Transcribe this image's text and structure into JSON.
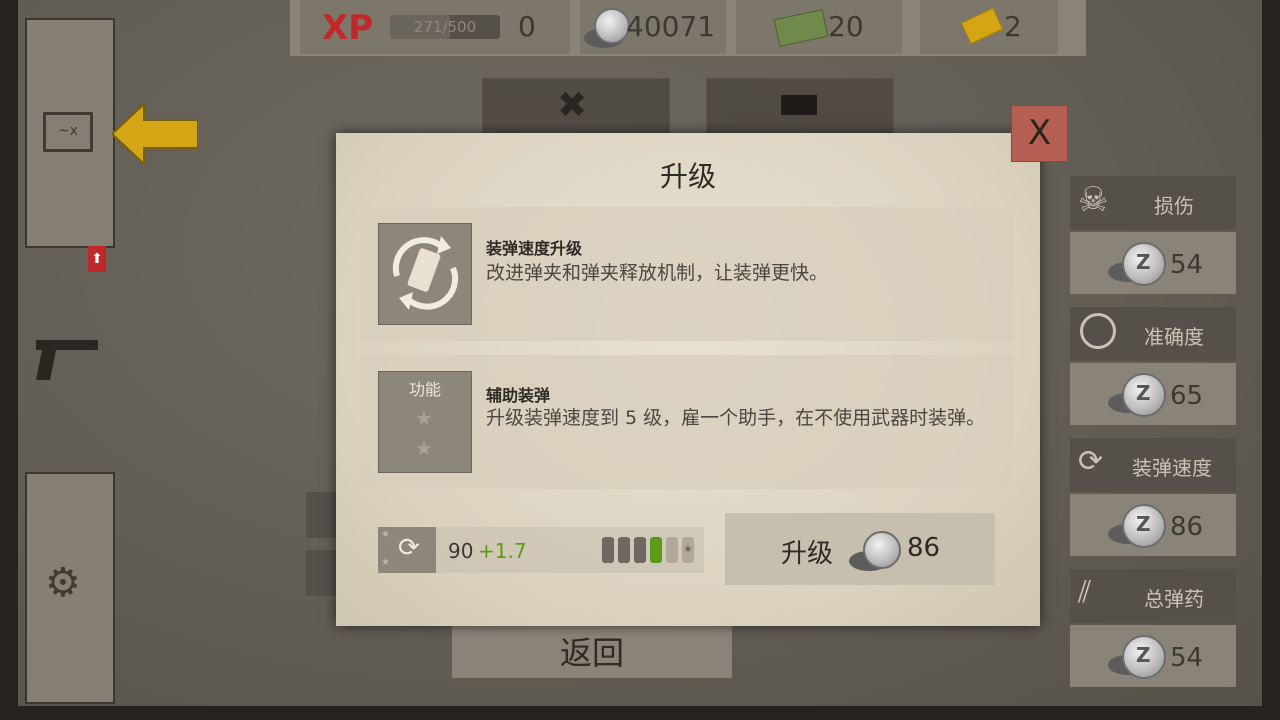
{
  "topbar": {
    "xp_label": "XP",
    "xp_progress": "271/500",
    "xp_value": "0",
    "coins": "40071",
    "cash": "20",
    "gold": "2"
  },
  "modal": {
    "title": "升级",
    "close_label": "X",
    "upgrade1": {
      "title": "装弹速度升级",
      "description": "改进弹夹和弹夹释放机制，让装弹更快。"
    },
    "upgrade2": {
      "tile_label": "功能",
      "title": "辅助装弹",
      "description": "升级装弹速度到 5 级，雇一个助手，在不使用武器时装弹。"
    },
    "stat": {
      "value": "90",
      "bonus": "+1.7",
      "level": 4,
      "max_level": 6
    },
    "upgrade_button": {
      "label": "升级",
      "cost": "86"
    }
  },
  "back_label": "返回",
  "stats": [
    {
      "label": "损伤",
      "cost": "54",
      "icon": "skull-icon"
    },
    {
      "label": "准确度",
      "cost": "65",
      "icon": "crosshair-icon"
    },
    {
      "label": "装弹速度",
      "cost": "86",
      "icon": "reload-icon"
    },
    {
      "label": "总弹药",
      "cost": "54",
      "icon": "ammo-icon"
    }
  ],
  "colors": {
    "xp_red": "#c0282a",
    "accent_yellow": "#d4a514",
    "bonus_green": "#5b9b1a",
    "close_red": "#b55f53"
  }
}
